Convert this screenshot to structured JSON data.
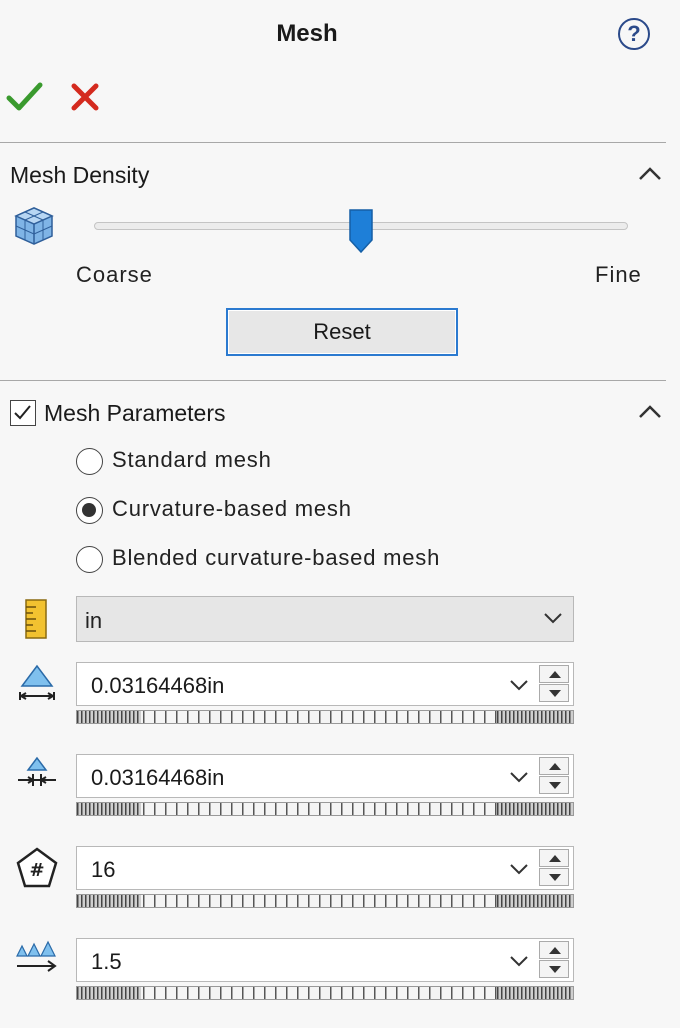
{
  "header": {
    "title": "Mesh",
    "help_icon": "help-icon",
    "help_glyph": "?"
  },
  "actions": {
    "ok_icon": "checkmark-icon",
    "cancel_icon": "close-icon",
    "ok_color": "#3a9a2e",
    "cancel_color": "#d42a1e"
  },
  "mesh_density": {
    "title": "Mesh Density",
    "icon": "mesh-cube-icon",
    "slider_level": 0.5,
    "coarse_label": "Coarse",
    "fine_label": "Fine",
    "reset_label": "Reset",
    "accent_color": "#1e7fd8"
  },
  "mesh_parameters": {
    "title": "Mesh Parameters",
    "enabled": true,
    "options": [
      {
        "label": "Standard mesh",
        "selected": false
      },
      {
        "label": "Curvature-based mesh",
        "selected": true
      },
      {
        "label": "Blended curvature-based mesh",
        "selected": false
      }
    ],
    "unit": {
      "icon": "ruler-icon",
      "value": "in"
    },
    "params": [
      {
        "icon": "max-element-size-icon",
        "value": "0.03164468in"
      },
      {
        "icon": "min-element-size-icon",
        "value": "0.03164468in"
      },
      {
        "icon": "elements-in-circle-icon",
        "value": "16"
      },
      {
        "icon": "growth-ratio-icon",
        "value": "1.5"
      }
    ]
  }
}
